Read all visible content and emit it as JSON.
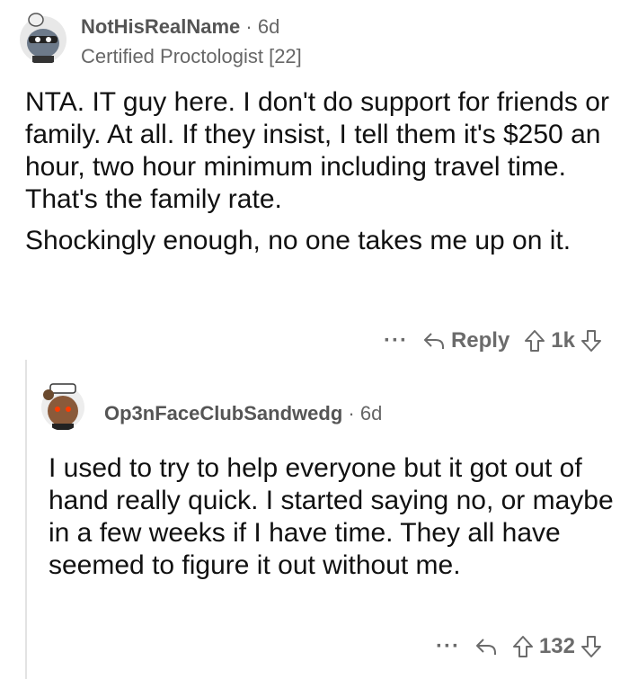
{
  "comments": [
    {
      "username": "NotHisRealName",
      "age": "6d",
      "flair": "Certified Proctologist [22]",
      "paragraphs": [
        "NTA. IT guy here. I don't do support for friends or family. At all. If they insist, I tell them it's $250 an hour, two hour minimum including travel time. That's the family rate.",
        "Shockingly enough, no one takes me up on it."
      ],
      "more_label": "···",
      "reply_label": "Reply",
      "score": "1k"
    },
    {
      "username": "Op3nFaceClubSandwedg",
      "age": "6d",
      "paragraphs": [
        "I used to try to help everyone but it got out of hand really quick. I started saying no, or maybe in a few weeks if I have time. They all have seemed to figure it out without me."
      ],
      "more_label": "···",
      "score": "132"
    }
  ],
  "icons": [
    "avatar",
    "reply-icon",
    "upvote-icon",
    "downvote-icon"
  ],
  "colors": {
    "text": "#111111",
    "meta": "#666666",
    "action": "#6b6b6b"
  }
}
